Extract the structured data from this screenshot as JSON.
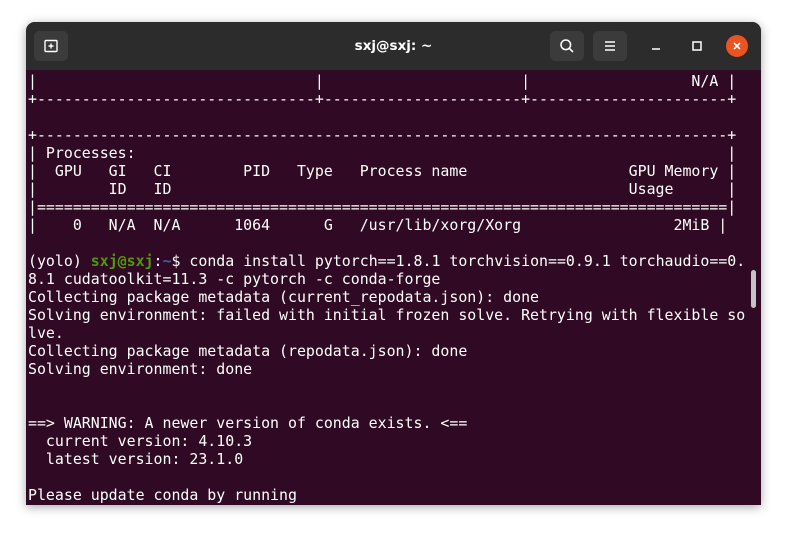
{
  "window": {
    "title": "sxj@sxj: ~",
    "close_color": "#e95420"
  },
  "titlebar": {
    "new_tab_icon": "new-tab-icon",
    "search_icon": "search-icon",
    "menu_icon": "hamburger-menu-icon",
    "minimize_icon": "minimize-icon",
    "maximize_icon": "maximize-icon",
    "close_icon": "close-icon"
  },
  "terminal": {
    "lines": [
      "|                               |                      |                  N/A |",
      "+-------------------------------+----------------------+----------------------+",
      "",
      "+-----------------------------------------------------------------------------+",
      "| Processes:                                                                  |",
      "|  GPU   GI   CI        PID   Type   Process name                  GPU Memory |",
      "|        ID   ID                                                   Usage      |",
      "|=============================================================================|",
      "|    0   N/A  N/A      1064      G   /usr/lib/xorg/Xorg                 2MiB |"
    ],
    "prompt": {
      "env": "(yolo) ",
      "user_host": "sxj@sxj",
      "separator": ":",
      "path": "~",
      "symbol": "$ ",
      "command": "conda install pytorch==1.8.1 torchvision==0.9.1 torchaudio==0."
    },
    "output": [
      "8.1 cudatoolkit=11.3 -c pytorch -c conda-forge",
      "Collecting package metadata (current_repodata.json): done",
      "Solving environment: failed with initial frozen solve. Retrying with flexible so",
      "lve.",
      "Collecting package metadata (repodata.json): done",
      "Solving environment: done",
      "",
      "",
      "==> WARNING: A newer version of conda exists. <==",
      "  current version: 4.10.3",
      "  latest version: 23.1.0",
      "",
      "Please update conda by running"
    ]
  }
}
